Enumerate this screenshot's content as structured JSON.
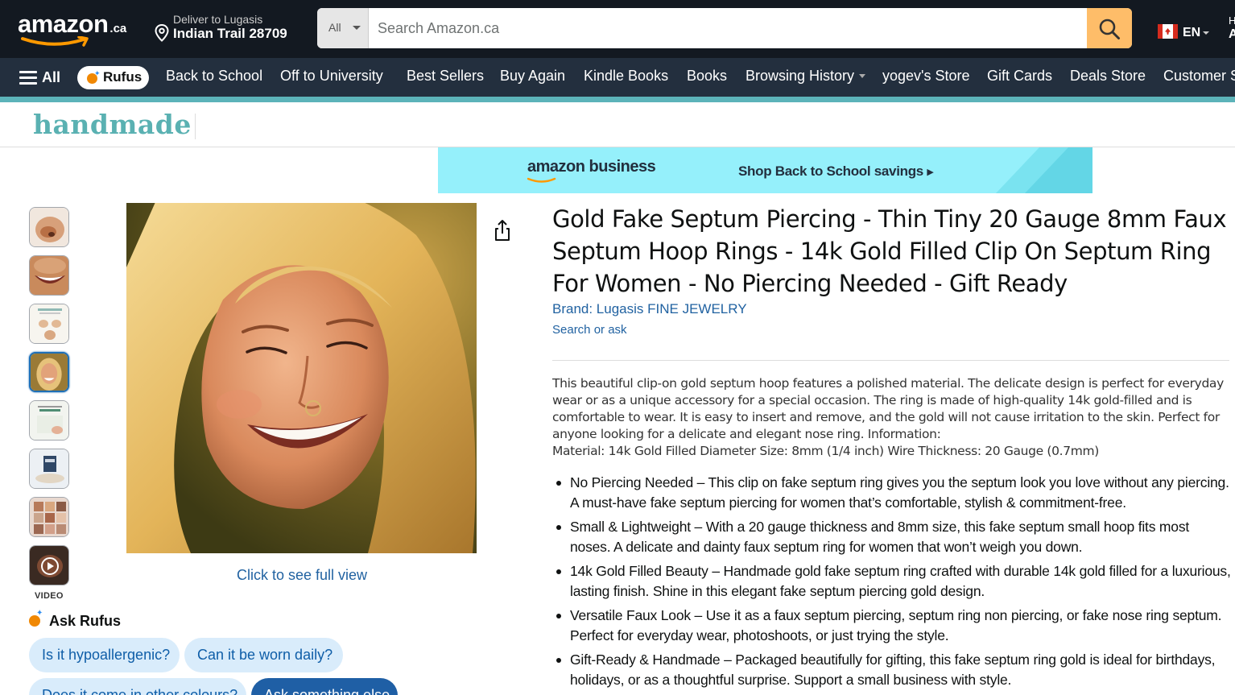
{
  "header": {
    "logo_word": "amazon",
    "logo_tld": ".ca",
    "deliver_line1": "Deliver to Lugasis",
    "deliver_line2": "Indian Trail 28709",
    "search_category": "All",
    "search_placeholder": "Search Amazon.ca",
    "language": "EN",
    "edge_line1": "H",
    "edge_line2": "A"
  },
  "subnav": {
    "all_label": "All",
    "rufus_label": "Rufus",
    "links": [
      "Back to School",
      "Off to University",
      "Best Sellers",
      "Buy Again",
      "Kindle Books",
      "Books",
      "Browsing History",
      "yogev's Store",
      "Gift Cards",
      "Deals Store",
      "Customer S"
    ]
  },
  "store_logo": "handmade",
  "ad": {
    "brand": "amazon business",
    "cta": "Shop Back to School savings"
  },
  "gallery": {
    "video_label": "VIDEO",
    "full_view_link": "Click to see full view"
  },
  "rufus": {
    "title": "Ask Rufus",
    "chips": [
      "Is it hypoallergenic?",
      "Can it be worn daily?",
      "Does it come in other colours?",
      "Ask something else"
    ]
  },
  "product": {
    "title": "Gold Fake Septum Piercing - Thin Tiny 20 Gauge 8mm Faux Septum Hoop Rings - 14k Gold Filled Clip On Septum Ring For Women - No Piercing Needed - Gift Ready",
    "brand": "Brand: Lugasis FINE JEWELRY",
    "search_or_ask": "Search or ask",
    "description": "This beautiful clip-on gold septum hoop features a polished material. The delicate design is perfect for everyday wear or as a unique accessory for a special occasion. The ring is made of high-quality 14k gold-filled and is comfortable to wear. It is easy to insert and remove, and the gold will not cause irritation to the skin. Perfect for anyone looking for a delicate and elegant nose ring. Information:",
    "description_line2": "Material: 14k Gold Filled Diameter Size: 8mm (1/4 inch) Wire Thickness: 20 Gauge (0.7mm)",
    "bullets": [
      "No Piercing Needed – This clip on fake septum ring gives you the septum look you love without any piercing. A must-have fake septum piercing for women that’s comfortable, stylish & commitment-free.",
      "Small & Lightweight – With a 20 gauge thickness and 8mm size, this fake septum small hoop fits most noses. A delicate and dainty faux septum ring for women that won’t weigh you down.",
      "14k Gold Filled Beauty – Handmade gold fake septum ring crafted with durable 14k gold filled for a luxurious, lasting finish. Shine in this elegant fake septum piercing gold design.",
      "Versatile Faux Look – Use it as a faux septum piercing, septum ring non piercing, or fake nose ring septum. Perfect for everyday wear, photoshoots, or just trying the style.",
      "Gift-Ready & Handmade – Packaged beautifully for gifting, this fake septum ring gold is ideal for birthdays, holidays, or as a thoughtful surprise. Support a small business with style."
    ]
  },
  "colors": {
    "nav_dark": "#131921",
    "subnav": "#232f3e",
    "search_button": "#febd69",
    "handmade_teal": "#5ab1b2",
    "link_blue": "#2162a1"
  }
}
